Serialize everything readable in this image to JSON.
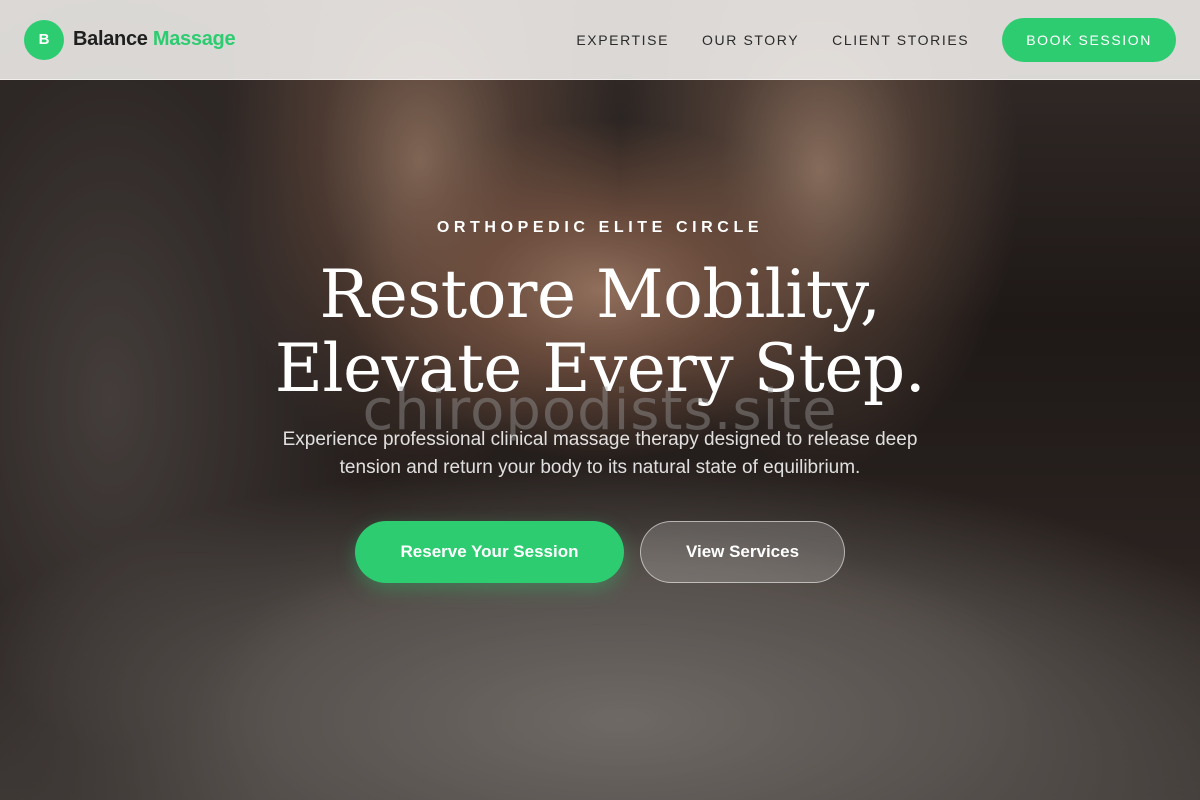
{
  "brand": {
    "mark": "B",
    "name_primary": "Balance",
    "name_accent": "Massage",
    "accent_color": "#2ecc71"
  },
  "nav": {
    "links": [
      {
        "label": "EXPERTISE"
      },
      {
        "label": "OUR STORY"
      },
      {
        "label": "CLIENT STORIES"
      }
    ],
    "cta_label": "BOOK SESSION"
  },
  "hero": {
    "eyebrow": "ORTHOPEDIC ELITE CIRCLE",
    "headline_line1": "Restore Mobility,",
    "headline_line2": "Elevate Every Step.",
    "subtext": "Experience professional clinical massage therapy designed to release deep tension and return your body to its natural state of equilibrium.",
    "primary_cta": "Reserve Your Session",
    "secondary_cta": "View Services",
    "background_image": "blurred-massage-therapy-photo"
  },
  "watermark": "chiropodists.site"
}
